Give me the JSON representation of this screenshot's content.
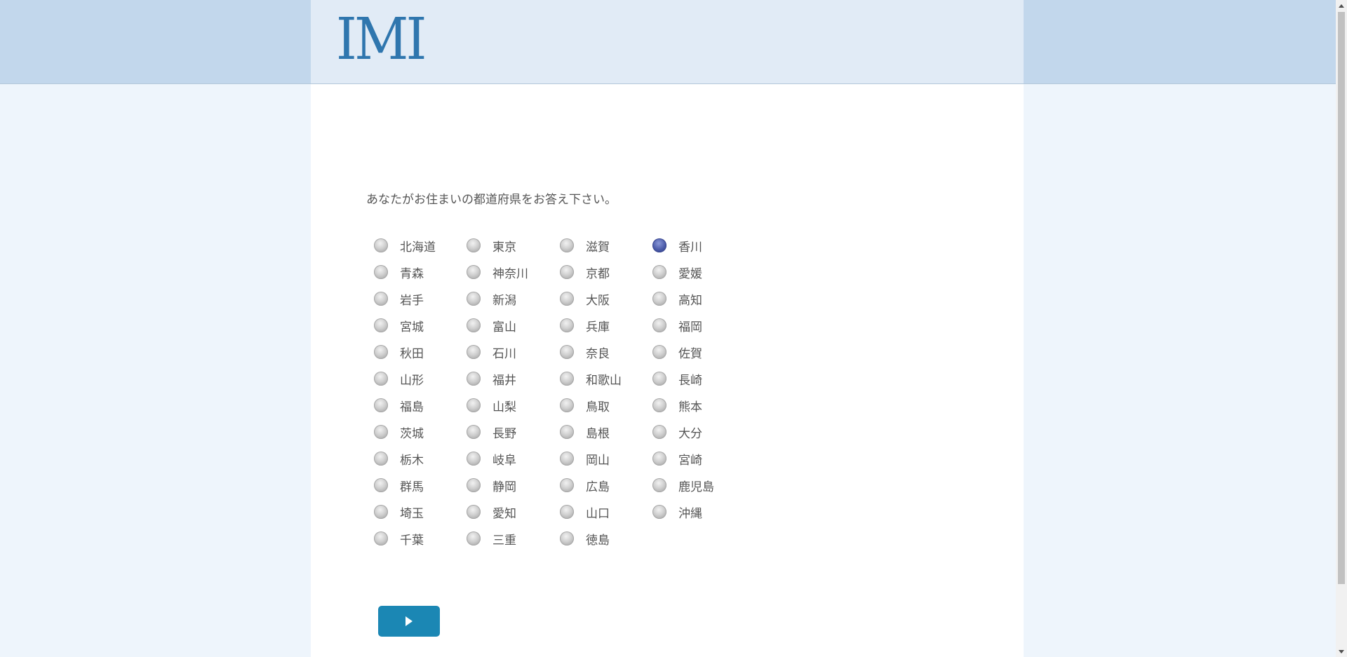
{
  "header": {
    "logo_text": "IMI"
  },
  "question": {
    "text": "あなたがお住まいの都道府県をお答え下さい。"
  },
  "options": [
    {
      "label": "北海道",
      "selected": false
    },
    {
      "label": "青森",
      "selected": false
    },
    {
      "label": "岩手",
      "selected": false
    },
    {
      "label": "宮城",
      "selected": false
    },
    {
      "label": "秋田",
      "selected": false
    },
    {
      "label": "山形",
      "selected": false
    },
    {
      "label": "福島",
      "selected": false
    },
    {
      "label": "茨城",
      "selected": false
    },
    {
      "label": "栃木",
      "selected": false
    },
    {
      "label": "群馬",
      "selected": false
    },
    {
      "label": "埼玉",
      "selected": false
    },
    {
      "label": "千葉",
      "selected": false
    },
    {
      "label": "東京",
      "selected": false
    },
    {
      "label": "神奈川",
      "selected": false
    },
    {
      "label": "新潟",
      "selected": false
    },
    {
      "label": "富山",
      "selected": false
    },
    {
      "label": "石川",
      "selected": false
    },
    {
      "label": "福井",
      "selected": false
    },
    {
      "label": "山梨",
      "selected": false
    },
    {
      "label": "長野",
      "selected": false
    },
    {
      "label": "岐阜",
      "selected": false
    },
    {
      "label": "静岡",
      "selected": false
    },
    {
      "label": "愛知",
      "selected": false
    },
    {
      "label": "三重",
      "selected": false
    },
    {
      "label": "滋賀",
      "selected": false
    },
    {
      "label": "京都",
      "selected": false
    },
    {
      "label": "大阪",
      "selected": false
    },
    {
      "label": "兵庫",
      "selected": false
    },
    {
      "label": "奈良",
      "selected": false
    },
    {
      "label": "和歌山",
      "selected": false
    },
    {
      "label": "鳥取",
      "selected": false
    },
    {
      "label": "島根",
      "selected": false
    },
    {
      "label": "岡山",
      "selected": false
    },
    {
      "label": "広島",
      "selected": false
    },
    {
      "label": "山口",
      "selected": false
    },
    {
      "label": "徳島",
      "selected": false
    },
    {
      "label": "香川",
      "selected": true
    },
    {
      "label": "愛媛",
      "selected": false
    },
    {
      "label": "高知",
      "selected": false
    },
    {
      "label": "福岡",
      "selected": false
    },
    {
      "label": "佐賀",
      "selected": false
    },
    {
      "label": "長崎",
      "selected": false
    },
    {
      "label": "熊本",
      "selected": false
    },
    {
      "label": "大分",
      "selected": false
    },
    {
      "label": "宮崎",
      "selected": false
    },
    {
      "label": "鹿児島",
      "selected": false
    },
    {
      "label": "沖縄",
      "selected": false
    }
  ],
  "next_button": {
    "icon": "play-triangle-icon"
  },
  "colors": {
    "header_band": "#c2d7ec",
    "header_inner": "#e1ebf6",
    "logo": "#2f76ae",
    "page_bg": "#eef5fc",
    "button": "#1b87b4",
    "radio_selected": "#4a5aa8"
  }
}
